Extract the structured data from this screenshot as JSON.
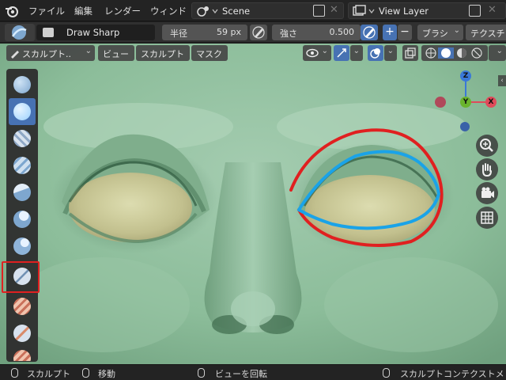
{
  "menu": {
    "items": [
      "ファイル",
      "編集",
      "レンダー",
      "ウィンド"
    ],
    "scene": "Scene",
    "view_layer": "View Layer"
  },
  "tool_settings": {
    "brush_name": "Draw Sharp",
    "radius_label": "半径",
    "radius_value": "59 px",
    "strength_label": "強さ",
    "strength_value": "0.500",
    "plus": "+",
    "minus": "−",
    "brush_menu": "ブラシ",
    "texture_menu": "テクスチ"
  },
  "viewport_header": {
    "mode": "スカルプト..",
    "view": "ビュー",
    "sculpt": "スカルプト",
    "mask": "マスク"
  },
  "gizmo": {
    "z": "Z",
    "y": "Y",
    "x": "X"
  },
  "tools": [
    {
      "name": "draw",
      "color": "#8fb4d9"
    },
    {
      "name": "draw-sharp",
      "color": "#9bd1ff",
      "active": true
    },
    {
      "name": "clay",
      "color": "#c7d4e6"
    },
    {
      "name": "clay-strips",
      "color": "#8fb4d9"
    },
    {
      "name": "layer",
      "color": "#8fb4d9"
    },
    {
      "name": "inflate",
      "color": "#8fb4d9"
    },
    {
      "name": "blob",
      "color": "#8fb4d9"
    },
    {
      "name": "crease",
      "color": "#b8c6d8",
      "highlighted": true
    },
    {
      "name": "smooth",
      "color": "#d98a6a"
    },
    {
      "name": "flatten",
      "color": "#d98a6a"
    },
    {
      "name": "fill",
      "color": "#d98a6a"
    }
  ],
  "statusbar": {
    "item1": "スカルプト",
    "item2": "移動",
    "item3": "ビューを回転",
    "item4": "スカルプトコンテクストメ"
  },
  "colors": {
    "accent": "#4772b3",
    "annotation_red": "#e02020",
    "annotation_blue": "#1aa3e8",
    "mesh_green": "#8fbf9c"
  }
}
